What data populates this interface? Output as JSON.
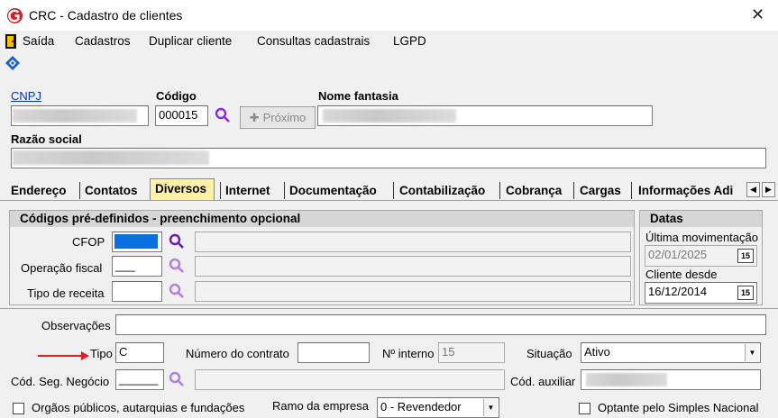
{
  "window": {
    "title": "CRC - Cadastro de clientes",
    "close": "✕"
  },
  "menu": {
    "saida": "Saída",
    "cadastros": "Cadastros",
    "duplicar": "Duplicar cliente",
    "consultas": "Consultas cadastrais",
    "lgpd": "LGPD"
  },
  "header": {
    "cnpj_label": "CNPJ",
    "codigo_label": "Código",
    "codigo_value": "000015",
    "proximo_label": "Próximo",
    "nome_fantasia_label": "Nome fantasia",
    "razao_social_label": "Razão social"
  },
  "tabs": [
    "Endereço",
    "Contatos",
    "Diversos",
    "Internet",
    "Documentação",
    "Contabilização",
    "Cobrança",
    "Cargas",
    "Informações Adi"
  ],
  "codigos": {
    "title": "Códigos pré-definidos - preenchimento opcional",
    "cfop_label": "CFOP",
    "operacao_label": "Operação fiscal",
    "operacao_value": "___",
    "receita_label": "Tipo de receita"
  },
  "datas": {
    "title": "Datas",
    "ultima_label": "Última movimentação",
    "ultima_value": "02/01/2025",
    "desde_label": "Cliente desde",
    "desde_value": "16/12/2014",
    "cal_label": "15"
  },
  "form": {
    "observacoes_label": "Observações",
    "tipo_label": "Tipo",
    "tipo_value": "C",
    "contrato_label": "Número do contrato",
    "interno_label": "Nº interno",
    "interno_value": "15",
    "situacao_label": "Situação",
    "situacao_value": "Ativo",
    "seg_label": "Cód. Seg. Negócio",
    "seg_value": "______",
    "auxiliar_label": "Cód. auxiliar",
    "orgaos_label": "Orgãos públicos, autarquias e fundações",
    "ramo_label": "Ramo da empresa",
    "ramo_value": "0 - Revendedor",
    "simples_label": "Optante pelo Simples Nacional"
  },
  "colors": {
    "active_tab": "#fff2a6",
    "arrow": "#e02020",
    "search_icon": "#8a2be2"
  }
}
